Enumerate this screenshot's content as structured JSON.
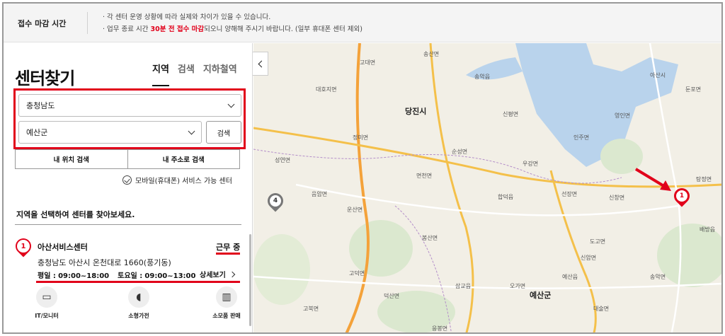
{
  "notice": {
    "title": "접수 마감 시간",
    "line1": "· 각 센터 운영 상황에 따라 실제와 차이가 있을 수 있습니다.",
    "line2_prefix": "· 업무 종료 시간 ",
    "line2_highlight": "30분 전 접수 마감",
    "line2_suffix": "되오니 양해해 주시기 바랍니다. (일부 휴대폰 센터 제외)"
  },
  "panel": {
    "title": "센터찾기",
    "tabs": [
      {
        "label": "지역"
      },
      {
        "label": "검색"
      },
      {
        "label": "지하철역"
      }
    ],
    "province": "충청남도",
    "district": "예산군",
    "search_label": "검색",
    "my_location_label": "내 위치 검색",
    "my_address_label": "내 주소로 검색",
    "mobile_service_label": "모바일(휴대폰) 서비스 가능 센터",
    "hint": "지역을 선택하여 센터를 찾아보세요."
  },
  "center": {
    "number": "1",
    "name": "아산서비스센터",
    "status": "근무 중",
    "address": "충청남도 아산시 온천대로 1660(풍기동)",
    "weekday_label": "평일 :",
    "weekday_hours": "09:00~18:00",
    "saturday_label": "토요일 :",
    "saturday_hours": "09:00~13:00",
    "detail_label": "상세보기",
    "services": [
      {
        "label": "IT/모니터",
        "icon": "laptop-icon"
      },
      {
        "label": "소형가전",
        "icon": "mouse-icon"
      },
      {
        "label": "소모품 판매",
        "icon": "toner-icon"
      }
    ]
  },
  "map": {
    "cluster_count": "4",
    "pin_number": "1",
    "labels": [
      {
        "text": "송산면",
        "big": false
      },
      {
        "text": "송악읍",
        "big": false
      },
      {
        "text": "고대면",
        "big": false
      },
      {
        "text": "대호지면",
        "big": false
      },
      {
        "text": "당진시",
        "big": true
      },
      {
        "text": "신평면",
        "big": false
      },
      {
        "text": "정미면",
        "big": false
      },
      {
        "text": "순성면",
        "big": false
      },
      {
        "text": "우강면",
        "big": false
      },
      {
        "text": "인주면",
        "big": false
      },
      {
        "text": "성연면",
        "big": false
      },
      {
        "text": "면천면",
        "big": false
      },
      {
        "text": "음암면",
        "big": false
      },
      {
        "text": "합덕읍",
        "big": false
      },
      {
        "text": "신창면",
        "big": false
      },
      {
        "text": "선장면",
        "big": false
      },
      {
        "text": "운산면",
        "big": false
      },
      {
        "text": "봉산면",
        "big": false
      },
      {
        "text": "도고면",
        "big": false
      },
      {
        "text": "삽교읍",
        "big": false
      },
      {
        "text": "오가면",
        "big": false
      },
      {
        "text": "예산군",
        "big": true
      },
      {
        "text": "고덕면",
        "big": false
      },
      {
        "text": "덕산면",
        "big": false
      },
      {
        "text": "신암면",
        "big": false
      },
      {
        "text": "송악면",
        "big": false
      },
      {
        "text": "영인면",
        "big": false
      },
      {
        "text": "둔포면",
        "big": false
      },
      {
        "text": "탕정면",
        "big": false
      },
      {
        "text": "배방읍",
        "big": false
      },
      {
        "text": "대술면",
        "big": false
      },
      {
        "text": "예산읍",
        "big": false
      },
      {
        "text": "아산시",
        "big": false
      },
      {
        "text": "고북면",
        "big": false
      },
      {
        "text": "응봉면",
        "big": false
      }
    ]
  }
}
